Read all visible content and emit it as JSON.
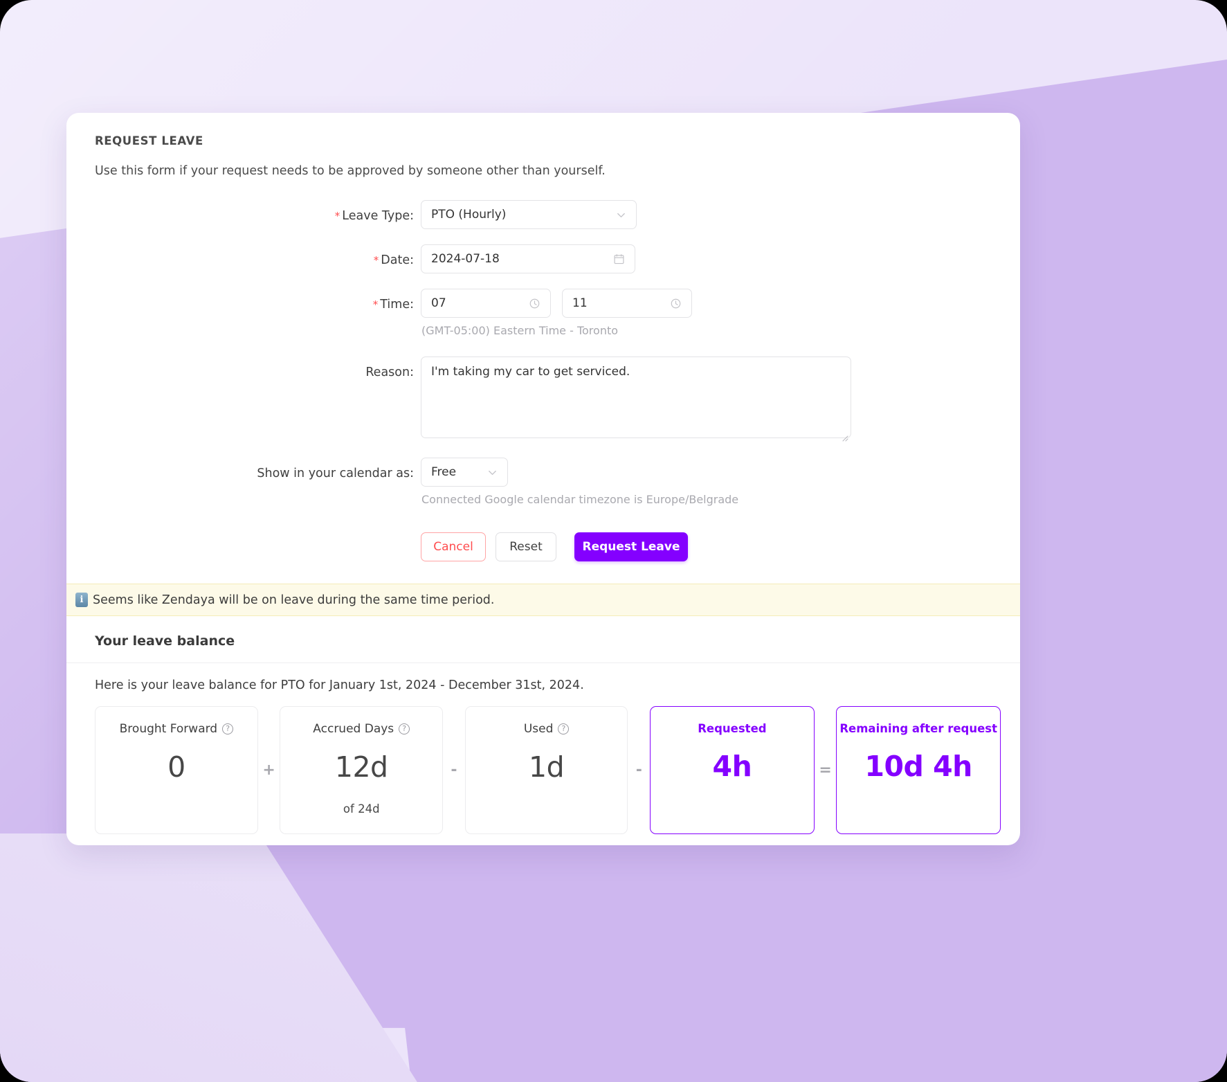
{
  "theme": {
    "accent": "#8400ff",
    "danger": "#ff4d4f",
    "banner_bg": "#fdfae8",
    "page_bg_light": "#ece4fa",
    "page_bg_dark": "#ccb4ee"
  },
  "card": {
    "section_title": "REQUEST LEAVE",
    "intro": "Use this form if your request needs to be approved by someone other than yourself."
  },
  "form": {
    "leave_type": {
      "label": "Leave Type:",
      "required_mark": "*",
      "value": "PTO (Hourly)",
      "options": [
        "PTO (Hourly)"
      ]
    },
    "date": {
      "label": "Date:",
      "required_mark": "*",
      "value": "2024-07-18",
      "placeholder": "Select date"
    },
    "time": {
      "label": "Time:",
      "required_mark": "*",
      "start_value": "07",
      "end_value": "11",
      "start_placeholder": "Start time",
      "end_placeholder": "End time",
      "timezone_hint": "(GMT-05:00) Eastern Time - Toronto"
    },
    "reason": {
      "label": "Reason:",
      "value": "I'm taking my car to get serviced.",
      "placeholder": ""
    },
    "calendar_show_as": {
      "label": "Show in your calendar as:",
      "value": "Free",
      "options": [
        "Free"
      ],
      "hint": "Connected Google calendar timezone is Europe/Belgrade"
    },
    "buttons": {
      "cancel": "Cancel",
      "reset": "Reset",
      "submit": "Request Leave"
    }
  },
  "banner": {
    "icon": "information-icon",
    "icon_glyph": "i",
    "text": "Seems like Zendaya will be on leave during the same time period."
  },
  "balance": {
    "heading": "Your leave balance",
    "subtitle": "Here is your leave balance for PTO for January 1st, 2024 - December 31st, 2024.",
    "cards": [
      {
        "label": "Brought Forward",
        "value": "0",
        "sub": "",
        "help": true,
        "highlight": false
      },
      {
        "label": "Accrued Days",
        "value": "12d",
        "sub": "of 24d",
        "help": true,
        "highlight": false
      },
      {
        "label": "Used",
        "value": "1d",
        "sub": "",
        "help": true,
        "highlight": false
      },
      {
        "label": "Requested",
        "value": "4h",
        "sub": "",
        "help": false,
        "highlight": true
      },
      {
        "label": "Remaining after request",
        "value": "10d 4h",
        "sub": "",
        "help": false,
        "highlight": true
      }
    ],
    "operators": [
      "+",
      "-",
      "-",
      "="
    ],
    "help_glyph": "?"
  }
}
